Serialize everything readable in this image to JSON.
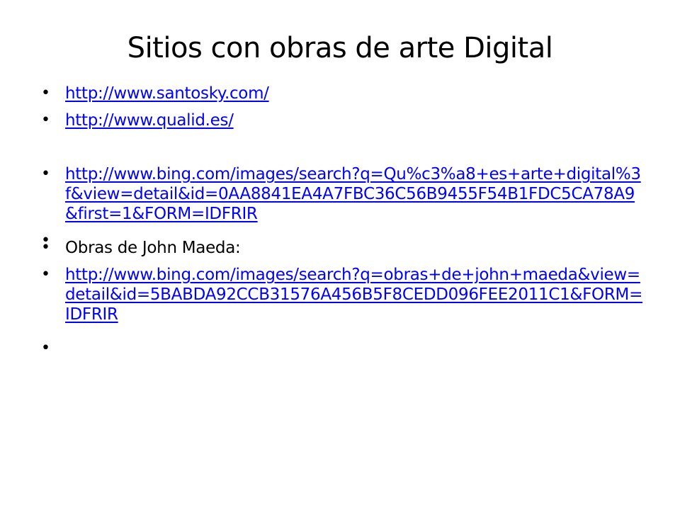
{
  "slide": {
    "title": "Sitios con obras de arte Digital",
    "bullet_char": "•",
    "items": [
      {
        "type": "link",
        "text": "http://www.santosky.com/"
      },
      {
        "type": "link",
        "text": "http://www.qualid.es/"
      },
      {
        "type": "link",
        "text": "http://www.bing.com/images/search?q=Qu%c3%a8+es+arte+digital%3f&view=detail&id=0AA8841EA4A7FBC36C56B9455F54B1FDC5CA78A9&first=1&FORM=IDFRIR"
      },
      {
        "type": "empty",
        "text": ""
      },
      {
        "type": "text",
        "text": "Obras de John Maeda:"
      },
      {
        "type": "link",
        "text": "http://www.bing.com/images/search?q=obras+de+john+maeda&view=detail&id=5BABDA92CCB31576A456B5F8CEDD096FEE2011C1&FORM=IDFRIR"
      },
      {
        "type": "empty",
        "text": ""
      },
      {
        "type": "empty",
        "text": ""
      }
    ]
  },
  "colors": {
    "link": "#0000ff",
    "text": "#000000",
    "background": "#ffffff"
  }
}
